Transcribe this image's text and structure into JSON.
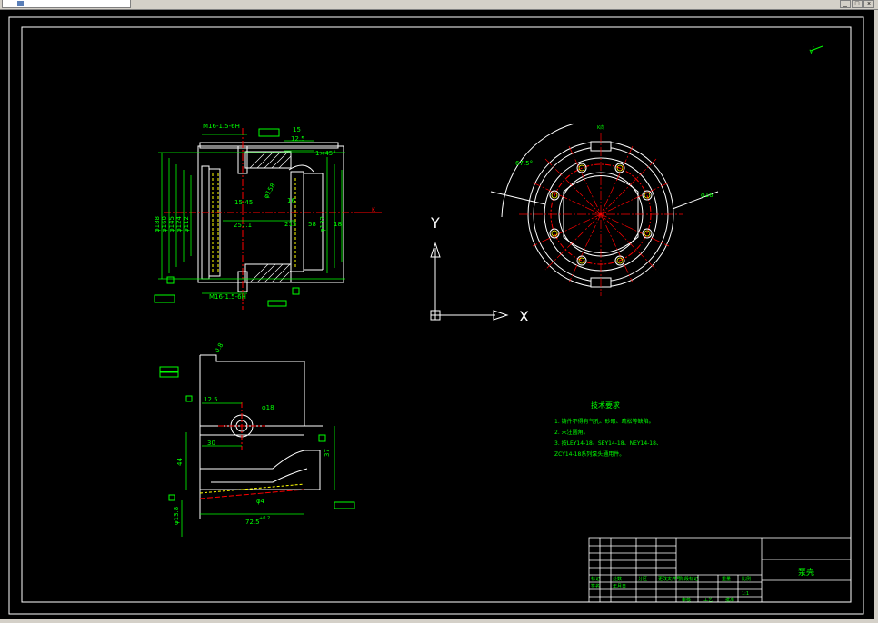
{
  "window": {
    "minimize_glyph": "_",
    "maximize_glyph": "□",
    "close_glyph": "×"
  },
  "colors": {
    "background": "#000000",
    "lines": "#ffffff",
    "dimensions": "#00ff00",
    "centerlines": "#ff0000",
    "hidden": "#ffff00"
  },
  "drawing": {
    "ucs": {
      "y_label": "Y",
      "x_label": "X"
    },
    "section_view": {
      "thread_top": "M16-1.5-6H",
      "thread_bottom": "M16-1.5-6H",
      "dim_15": "15",
      "dim_12_5": "12.5",
      "chamfer_label": "1×45°",
      "dim_15_45": "15-45",
      "dim_257": "257.1",
      "dim_215": "215",
      "dim_16": "16",
      "dim_18": "18",
      "dim_58": "58",
      "dim_phi188": "φ188",
      "dim_phi160": "φ160",
      "dim_phi145": "φ145",
      "dim_phi124": "φ124",
      "dim_phi112": "φ112",
      "dim_phi132": "φ132",
      "dim_phi158": "φ158"
    },
    "plan_view": {
      "angle_label": "67.5°",
      "pcd_label": "φ16",
      "top_label": "K向"
    },
    "side_view": {
      "dim_12_5": "12.5",
      "dim_30": "30",
      "dim_44": "44",
      "dim_37": "37",
      "hole_dia": "φ18",
      "dim_72_5": "72.5",
      "tol_top": "+0.2",
      "bottom_dia": "φ4",
      "left_dia": "φ13.8",
      "roughness": "0.8"
    },
    "section_marker": "K",
    "tech_requirements": {
      "title": "技术要求",
      "items": [
        "1. 铸件不得有气孔、砂眼、疏松等缺陷。",
        "2. 未注圆角。",
        "3. 按LEY14-18、SEY14-18、NEY14-18、",
        "   ZCY14-18系列泵头通用件。"
      ]
    },
    "title_block": {
      "part_name": "泵壳",
      "row_labels": [
        "标记",
        "处数",
        "分区",
        "更改文件号",
        "签名",
        "年月日"
      ],
      "col_labels": [
        "阶段标记",
        "重量",
        "比例"
      ],
      "bottom_labels": [
        "审核",
        "工艺",
        "批准"
      ],
      "scale": "1:1"
    },
    "roughness_mark": "√"
  }
}
